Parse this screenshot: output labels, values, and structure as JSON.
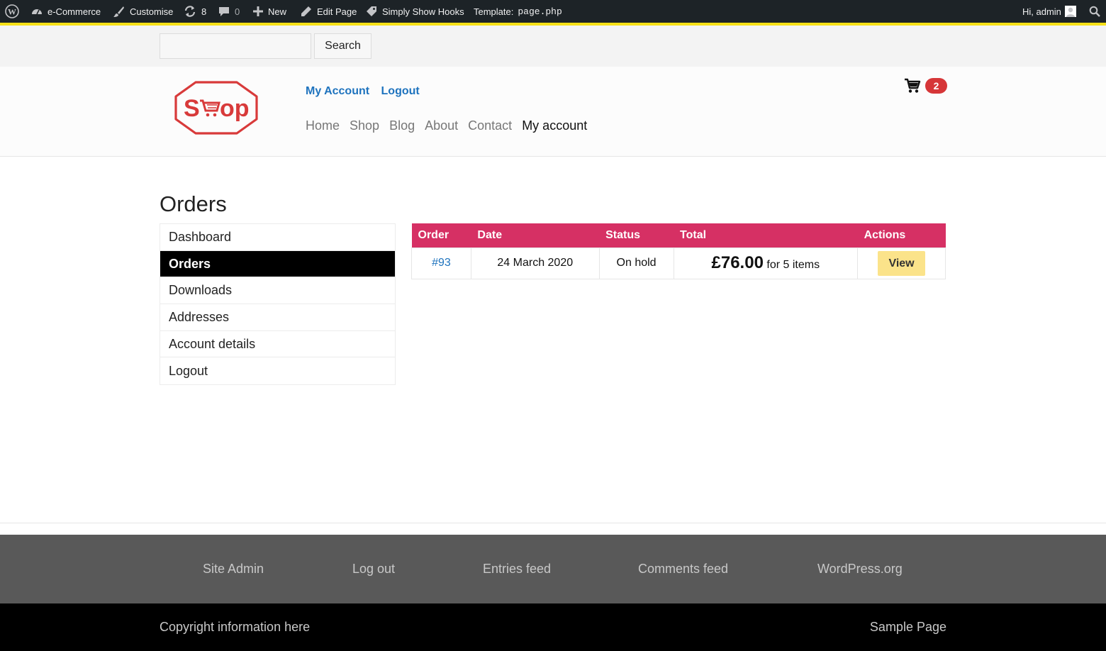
{
  "admin_bar": {
    "site_name": "e-Commerce",
    "customise": "Customise",
    "updates_count": "8",
    "comments_count": "0",
    "new": "New",
    "edit_page": "Edit Page",
    "hooks": "Simply Show Hooks",
    "template_label": "Template:",
    "template_file": "page.php",
    "greeting": "Hi, admin"
  },
  "search": {
    "value": "",
    "button_label": "Search"
  },
  "header": {
    "logo_text": "Shop",
    "top_links": [
      "My Account",
      "Logout"
    ],
    "nav": [
      "Home",
      "Shop",
      "Blog",
      "About",
      "Contact",
      "My account"
    ],
    "nav_current": "My account",
    "cart_count": "2"
  },
  "page": {
    "title": "Orders"
  },
  "account_nav": {
    "items": [
      "Dashboard",
      "Orders",
      "Downloads",
      "Addresses",
      "Account details",
      "Logout"
    ],
    "active": "Orders"
  },
  "orders": {
    "headers": [
      "Order",
      "Date",
      "Status",
      "Total",
      "Actions"
    ],
    "rows": [
      {
        "order": "#93",
        "date": "24 March 2020",
        "status": "On hold",
        "total": "£76.00",
        "items": "for 5 items",
        "action": "View"
      }
    ]
  },
  "footer": {
    "links": [
      "Site Admin",
      "Log out",
      "Entries feed",
      "Comments feed",
      "WordPress.org"
    ],
    "copyright": "Copyright information here",
    "sample_page": "Sample Page"
  },
  "colors": {
    "admin_bar": "#1d2327",
    "accent_line": "#f7e017",
    "link_blue": "#1e73be",
    "table_header": "#d63064",
    "cart_badge": "#d63638",
    "view_button": "#fbe38a",
    "footer_links_bg": "#595959",
    "footer_bottom_bg": "#000000"
  }
}
